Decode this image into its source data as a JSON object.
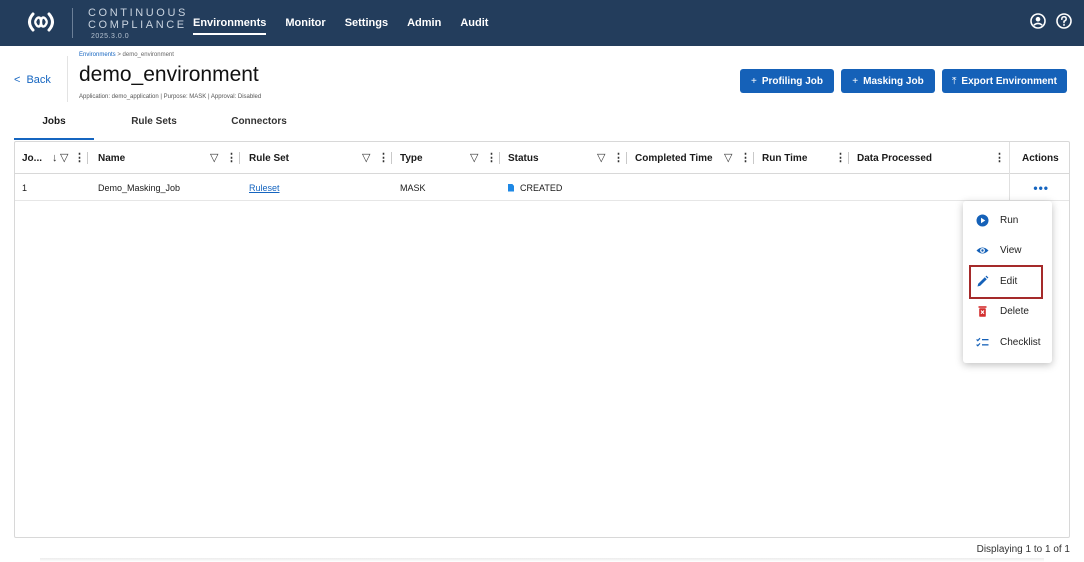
{
  "brand": {
    "line1": "CONTINUOUS",
    "line2": "COMPLIANCE",
    "version": "2025.3.0.0"
  },
  "nav": {
    "links": [
      "Environments",
      "Monitor",
      "Settings",
      "Admin",
      "Audit"
    ],
    "active": "Environments",
    "right_icons": [
      "account-icon",
      "help-icon"
    ]
  },
  "header": {
    "back_label": "Back",
    "breadcrumb": {
      "parent": "Environments",
      "separator": ">",
      "current": "demo_environment"
    },
    "title": "demo_environment",
    "subtitle": "Application: demo_application | Purpose: MASK | Approval: Disabled",
    "buttons": [
      {
        "glyph": "+",
        "label": "Profiling Job"
      },
      {
        "glyph": "+",
        "label": "Masking Job"
      },
      {
        "glyph": "⤒",
        "label": "Export Environment"
      }
    ]
  },
  "tabs": [
    "Jobs",
    "Rule Sets",
    "Connectors"
  ],
  "active_tab": "Jobs",
  "grid": {
    "columns": [
      "Jo...",
      "Name",
      "Rule Set",
      "Type",
      "Status",
      "Completed Time",
      "Run Time",
      "Data Processed",
      "Actions"
    ],
    "rows": [
      {
        "id": "1",
        "name": "Demo_Masking_Job",
        "rule_set": "Ruleset",
        "type": "MASK",
        "status": "CREATED",
        "completed_time": "",
        "run_time": "",
        "data_processed": "",
        "actions": "•••"
      }
    ]
  },
  "menu": {
    "items": [
      {
        "icon": "play-icon",
        "label": "Run"
      },
      {
        "icon": "eye-icon",
        "label": "View"
      },
      {
        "icon": "pencil-icon",
        "label": "Edit"
      },
      {
        "icon": "trash-icon",
        "label": "Delete"
      },
      {
        "icon": "checklist-icon",
        "label": "Checklist"
      }
    ],
    "highlighted": "Edit"
  },
  "footer": {
    "text": "Displaying 1 to 1 of 1"
  },
  "colors": {
    "nav_bg": "#233d5c",
    "primary": "#1561b8",
    "link": "#1565c0",
    "highlight_border": "#a52a2a",
    "delete_red": "#d32f2f"
  }
}
